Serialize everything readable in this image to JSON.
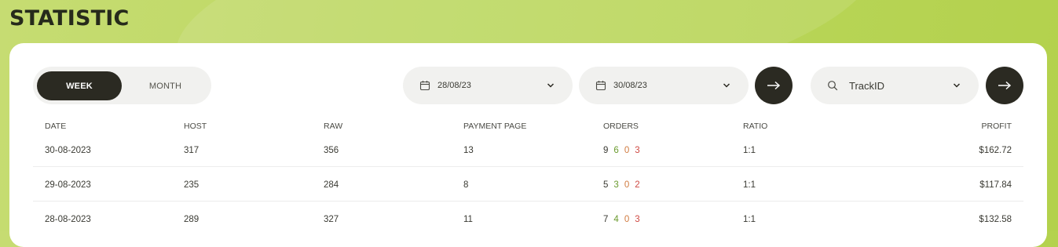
{
  "page": {
    "title": "STATISTIC"
  },
  "period": {
    "week_label": "WEEK",
    "month_label": "MONTH",
    "selected": "WEEK"
  },
  "date_from": {
    "value": "28/08/23",
    "icon": "calendar-icon"
  },
  "date_to": {
    "value": "30/08/23",
    "icon": "calendar-icon"
  },
  "track": {
    "label": "TrackID",
    "icon": "search-icon"
  },
  "colors": {
    "accent_bg": "#b7d452",
    "dark": "#2b2a22",
    "orders_ok": "#6a9a2e",
    "orders_pending": "#d07a3e",
    "orders_fail": "#cf4a44"
  },
  "table": {
    "headers": {
      "date": "DATE",
      "host": "HOST",
      "raw": "RAW",
      "payment_page": "PAYMENT PAGE",
      "orders": "ORDERS",
      "ratio": "RATIO",
      "profit": "PROFIT"
    },
    "rows": [
      {
        "date": "30-08-2023",
        "host": "317",
        "raw": "356",
        "payment_page": "13",
        "orders": {
          "total": "9",
          "ok": "6",
          "pending": "0",
          "fail": "3"
        },
        "ratio": "1:1",
        "profit": "$162.72"
      },
      {
        "date": "29-08-2023",
        "host": "235",
        "raw": "284",
        "payment_page": "8",
        "orders": {
          "total": "5",
          "ok": "3",
          "pending": "0",
          "fail": "2"
        },
        "ratio": "1:1",
        "profit": "$117.84"
      },
      {
        "date": "28-08-2023",
        "host": "289",
        "raw": "327",
        "payment_page": "11",
        "orders": {
          "total": "7",
          "ok": "4",
          "pending": "0",
          "fail": "3"
        },
        "ratio": "1:1",
        "profit": "$132.58"
      }
    ]
  }
}
